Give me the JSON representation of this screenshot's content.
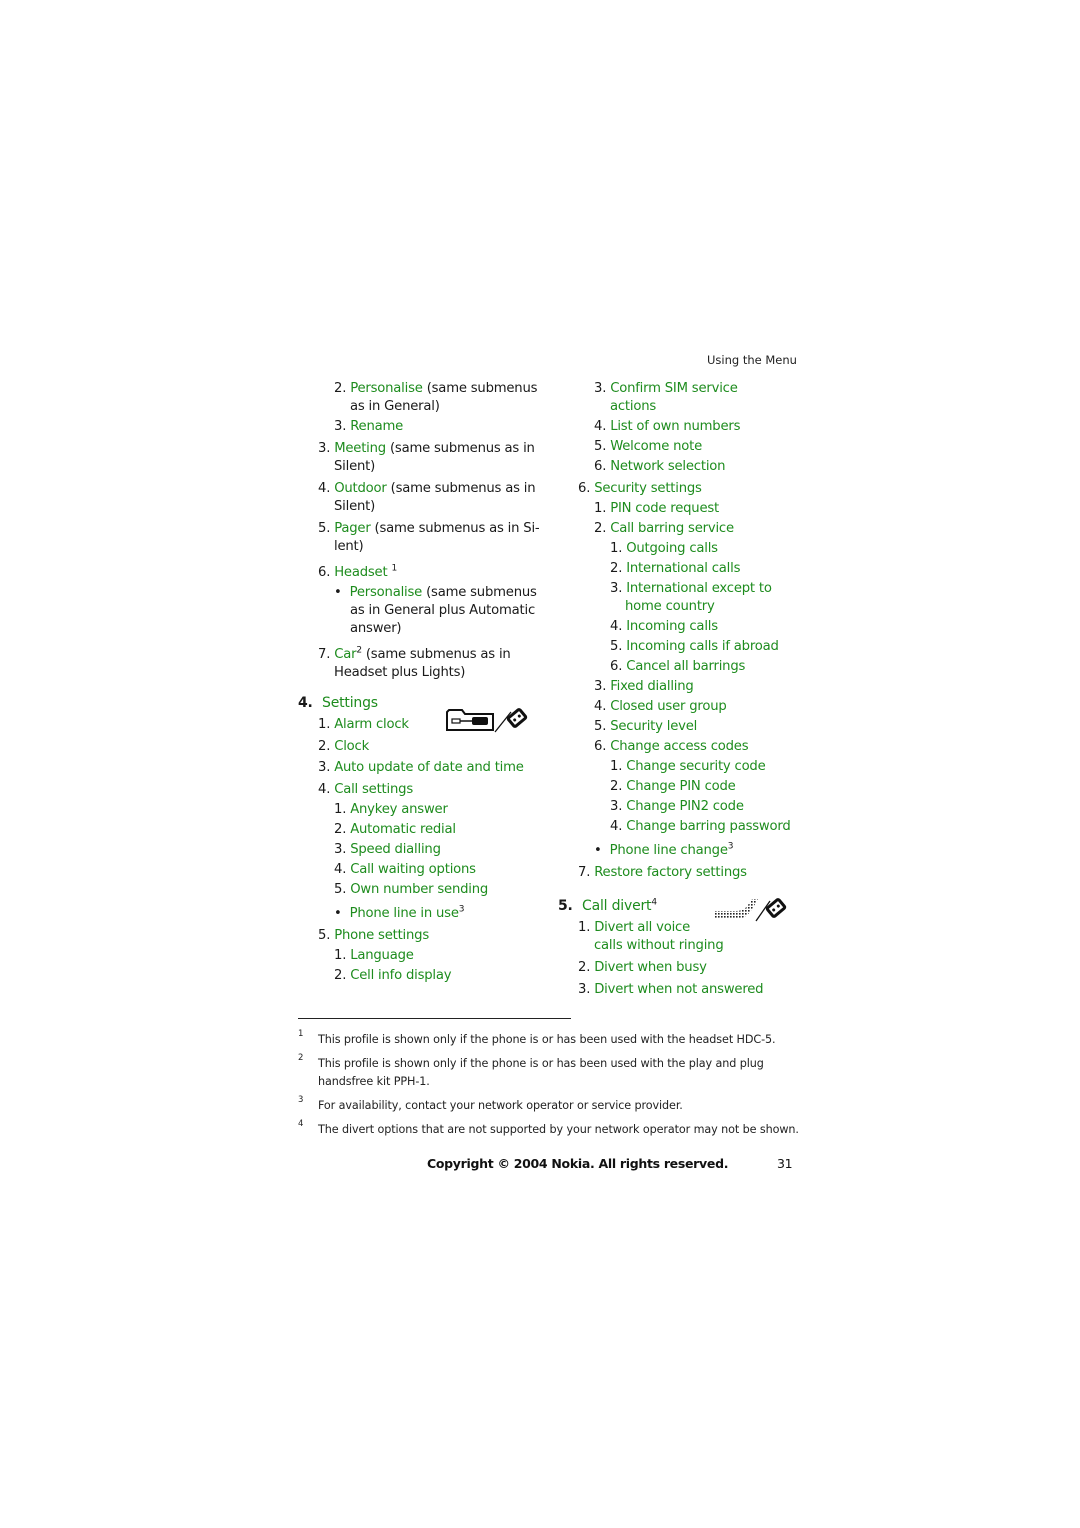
{
  "header": {
    "section_title": "Using the Menu"
  },
  "left_column": {
    "l1": {
      "num": "2.",
      "link": "Personalise",
      "rest": " (same submenus"
    },
    "l1b": "as in General)",
    "l2": {
      "num": "3.",
      "link": "Rename"
    },
    "l3": {
      "num": "3.",
      "link": "Meeting",
      "rest": " (same submenus as in"
    },
    "l3b": "Silent)",
    "l4": {
      "num": "4.",
      "link": "Outdoor",
      "rest": " (same submenus as in"
    },
    "l4b": "Silent)",
    "l5": {
      "num": "5.",
      "link": "Pager",
      "rest": " (same submenus as in Si-"
    },
    "l5b": "lent)",
    "l6": {
      "num": "6.",
      "link": "Headset",
      "sup": "1"
    },
    "l7": {
      "bullet": "•",
      "link": "Personalise",
      "rest": " (same submenus"
    },
    "l7b": "as in General plus Automatic",
    "l7c": "answer)",
    "l8": {
      "num": "7.",
      "link": "Car",
      "sup": "2",
      "rest": " (same submenus as in"
    },
    "l8b": "Headset plus Lights)",
    "settings": {
      "num": "4.",
      "title": "Settings"
    },
    "s1": {
      "num": "1.",
      "link": "Alarm clock"
    },
    "s2": {
      "num": "2.",
      "link": "Clock"
    },
    "s3": {
      "num": "3.",
      "link": "Auto update of date and time"
    },
    "s4": {
      "num": "4.",
      "link": "Call settings"
    },
    "s4_1": {
      "num": "1.",
      "link": "Anykey answer"
    },
    "s4_2": {
      "num": "2.",
      "link": "Automatic redial"
    },
    "s4_3": {
      "num": "3.",
      "link": "Speed dialling"
    },
    "s4_4": {
      "num": "4.",
      "link": "Call waiting options"
    },
    "s4_5": {
      "num": "5.",
      "link": "Own number sending"
    },
    "s4_6": {
      "bullet": "•",
      "link": "Phone line in use",
      "sup": "3"
    },
    "s5": {
      "num": "5.",
      "link": "Phone settings"
    },
    "s5_1": {
      "num": "1.",
      "link": "Language"
    },
    "s5_2": {
      "num": "2.",
      "link": "Cell info display"
    }
  },
  "right_column": {
    "r1": {
      "num": "3.",
      "link": "Confirm SIM service"
    },
    "r1b": "actions",
    "r2": {
      "num": "4.",
      "link": "List of own numbers"
    },
    "r3": {
      "num": "5.",
      "link": "Welcome note"
    },
    "r4": {
      "num": "6.",
      "link": "Network selection"
    },
    "r5": {
      "num": "6.",
      "link": "Security settings"
    },
    "r5_1": {
      "num": "1.",
      "link": "PIN code request"
    },
    "r5_2": {
      "num": "2.",
      "link": "Call barring service"
    },
    "r5_2_1": {
      "num": "1.",
      "link": "Outgoing calls"
    },
    "r5_2_2": {
      "num": "2.",
      "link": "International calls"
    },
    "r5_2_3": {
      "num": "3.",
      "link": "International except to"
    },
    "r5_2_3b": "home country",
    "r5_2_4": {
      "num": "4.",
      "link": "Incoming calls"
    },
    "r5_2_5": {
      "num": "5.",
      "link": "Incoming calls if abroad"
    },
    "r5_2_6": {
      "num": "6.",
      "link": "Cancel all barrings"
    },
    "r5_3": {
      "num": "3.",
      "link": "Fixed dialling"
    },
    "r5_4": {
      "num": "4.",
      "link": "Closed user group"
    },
    "r5_5": {
      "num": "5.",
      "link": "Security level"
    },
    "r5_6": {
      "num": "6.",
      "link": "Change access codes"
    },
    "r5_6_1": {
      "num": "1.",
      "link": "Change security code"
    },
    "r5_6_2": {
      "num": "2.",
      "link": "Change PIN code"
    },
    "r5_6_3": {
      "num": "3.",
      "link": "Change PIN2 code"
    },
    "r5_6_4": {
      "num": "4.",
      "link": "Change barring password"
    },
    "r5_7": {
      "bullet": "•",
      "link": "Phone line change",
      "sup": "3"
    },
    "r6": {
      "num": "7.",
      "link": "Restore factory settings"
    },
    "divert": {
      "num": "5.",
      "title": "Call divert",
      "sup": "4"
    },
    "d1": {
      "num": "1.",
      "link": "Divert all voice"
    },
    "d1b": "calls without ringing",
    "d2": {
      "num": "2.",
      "link": "Divert when busy"
    },
    "d3": {
      "num": "3.",
      "link": "Divert when not answered"
    }
  },
  "icons": {
    "settings": "settings-tools-icon",
    "divert": "call-divert-icon"
  },
  "footnotes": [
    {
      "mark": "1",
      "text": "This profile is shown only if the phone is or has been used with the headset HDC-5."
    },
    {
      "mark": "2",
      "text": "This profile is shown only if the phone is or has been used with the play and plug",
      "text2": "handsfree kit PPH-1."
    },
    {
      "mark": "3",
      "text": "For availability, contact your network operator or service provider."
    },
    {
      "mark": "4",
      "text": "The divert options that are not supported by your network operator may not be shown."
    }
  ],
  "footer": {
    "copyright": "Copyright © 2004 Nokia. All rights reserved.",
    "page_number": "31"
  },
  "colors": {
    "link_green": "#1e8c1e",
    "text": "#1a1a1a"
  }
}
